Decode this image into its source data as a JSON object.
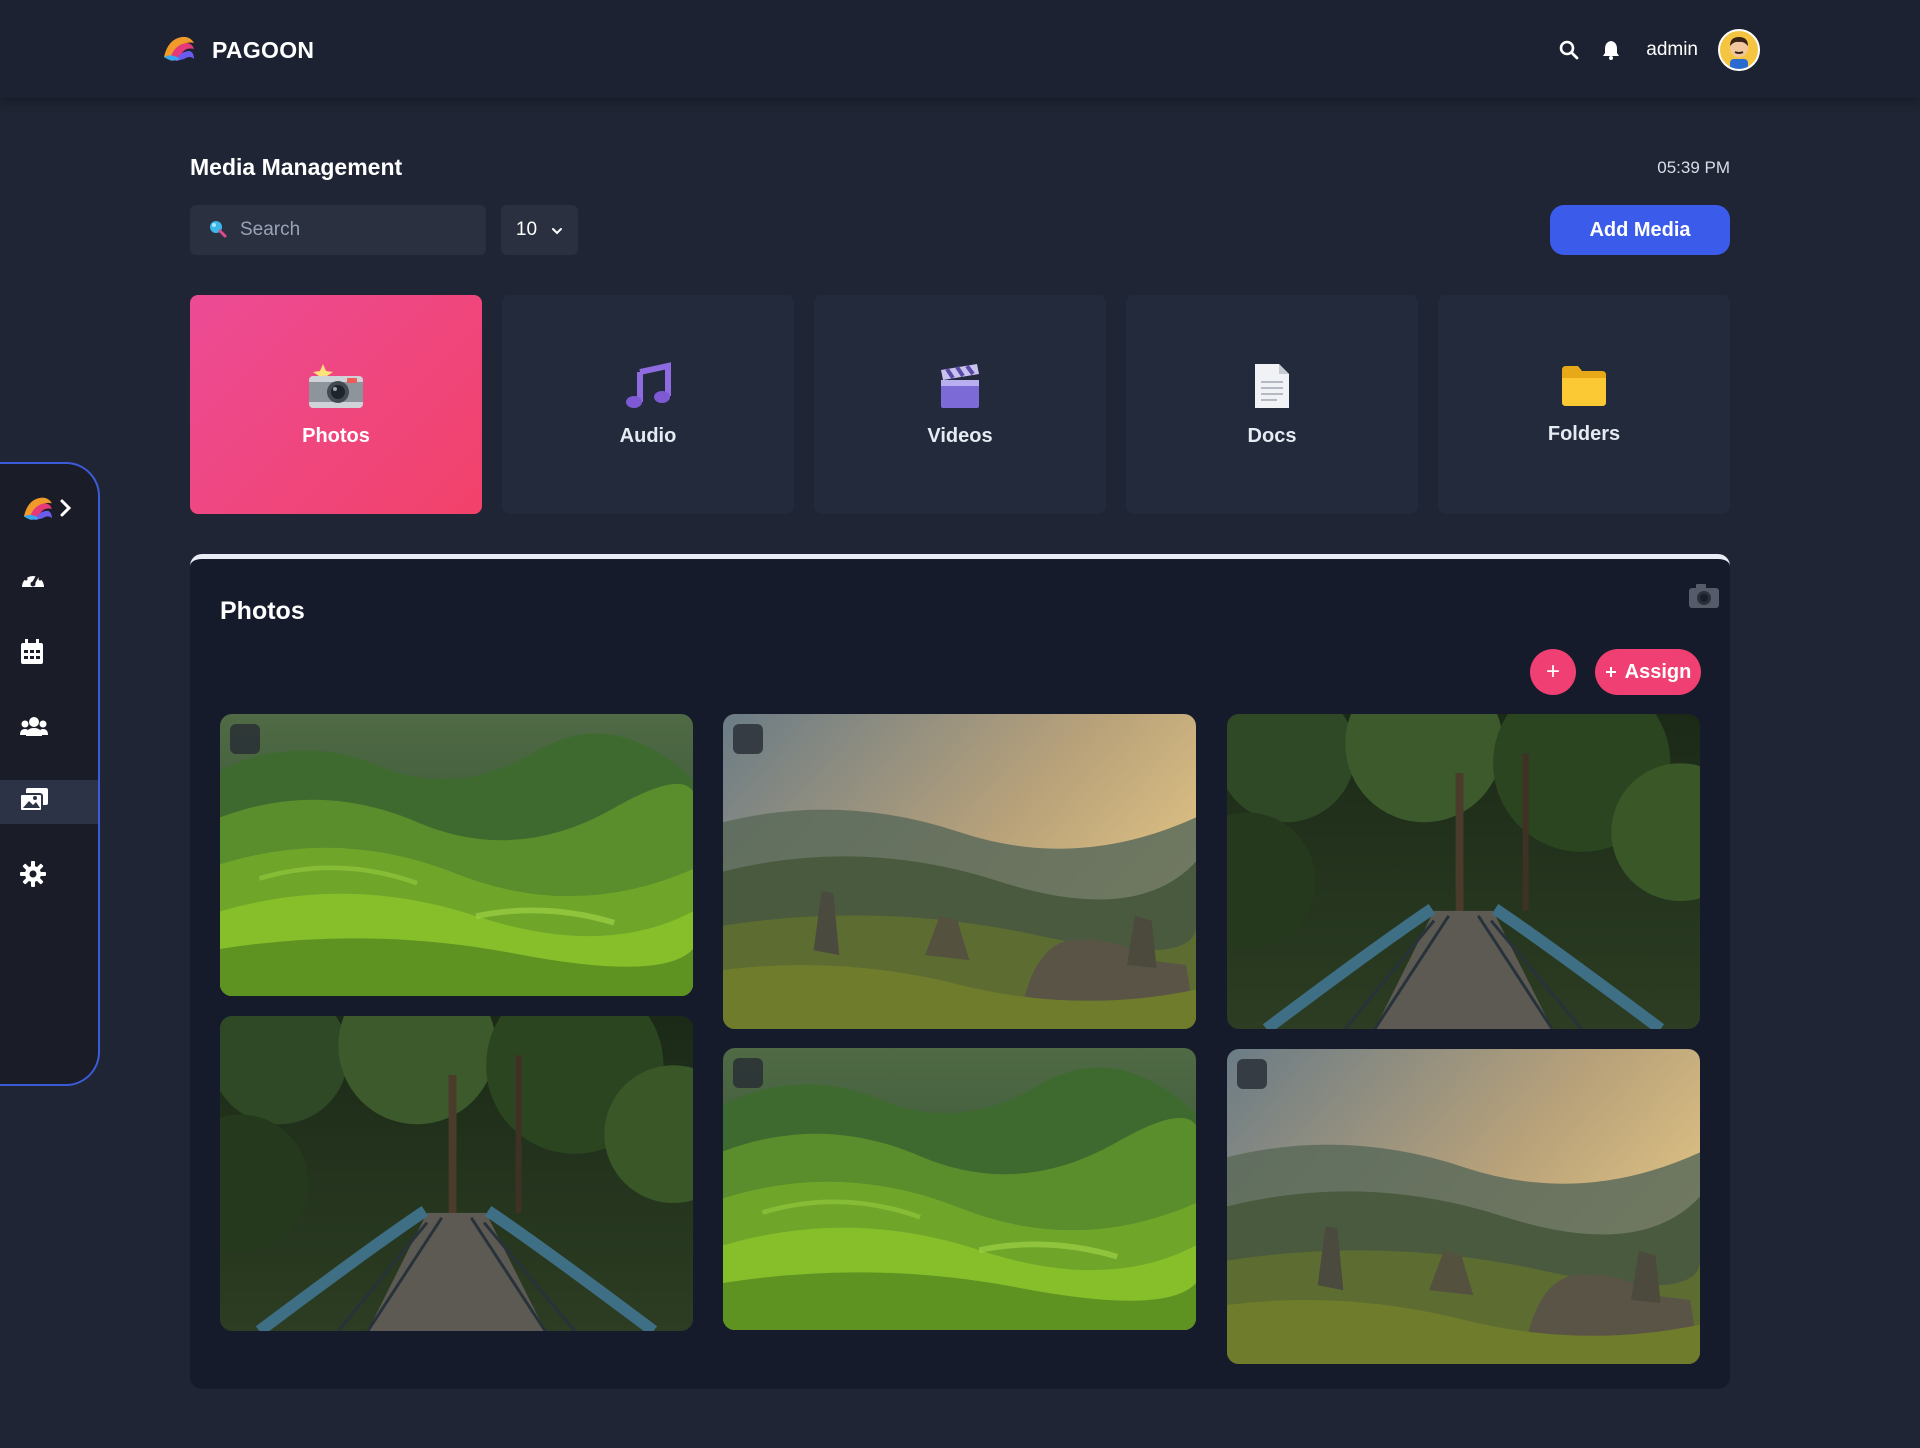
{
  "app": {
    "name": "PAGOON"
  },
  "header": {
    "user_name": "admin"
  },
  "page": {
    "title": "Media Management",
    "time": "05:39 PM"
  },
  "toolbar": {
    "search_placeholder": "Search",
    "page_size": "10",
    "add_label": "Add Media"
  },
  "categories": [
    {
      "label": "Photos",
      "icon": "camera-flash-icon",
      "active": true
    },
    {
      "label": "Audio",
      "icon": "music-note-icon",
      "active": false
    },
    {
      "label": "Videos",
      "icon": "clapperboard-icon",
      "active": false
    },
    {
      "label": "Docs",
      "icon": "document-icon",
      "active": false
    },
    {
      "label": "Folders",
      "icon": "folder-icon",
      "active": false
    }
  ],
  "sidebar": {
    "items": [
      {
        "name": "dashboard",
        "icon": "speedometer-icon"
      },
      {
        "name": "calendar",
        "icon": "calendar-icon"
      },
      {
        "name": "users",
        "icon": "users-icon"
      },
      {
        "name": "media",
        "icon": "media-gallery-icon",
        "active": true
      },
      {
        "name": "settings",
        "icon": "gear-icon"
      }
    ]
  },
  "panel": {
    "title": "Photos",
    "plus_label": "+",
    "assign_label": "Assign",
    "photos": [
      {
        "scene": "green-hills"
      },
      {
        "scene": "mountain-valley-sunset"
      },
      {
        "scene": "forest-bridge"
      },
      {
        "scene": "forest-bridge"
      },
      {
        "scene": "green-hills"
      },
      {
        "scene": "mountain-valley-sunset"
      }
    ]
  },
  "colors": {
    "background": "#1f2534",
    "panel": "#151b2a",
    "accent_blue": "#3b5bea",
    "accent_pink": "#ef3f73",
    "active_card_gradient": [
      "#ec4b95",
      "#f2426a"
    ]
  }
}
